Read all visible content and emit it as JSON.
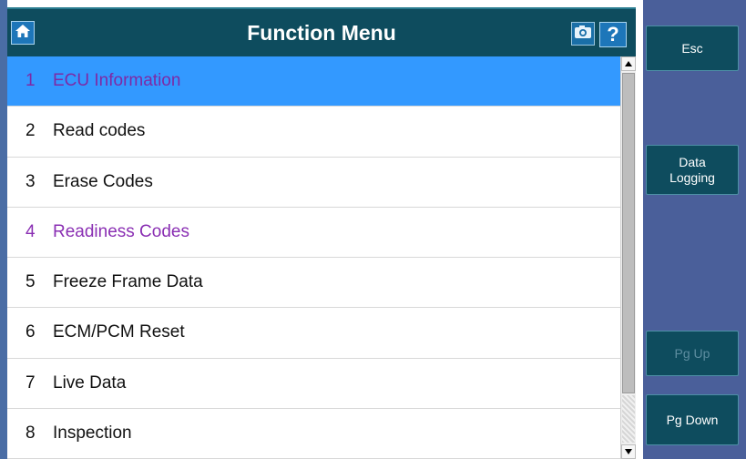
{
  "header": {
    "title": "Function Menu",
    "home_icon": "home-icon",
    "camera_icon": "camera-icon",
    "help_label": "?"
  },
  "menu": {
    "items": [
      {
        "number": "1",
        "label": "ECU Information",
        "state": "selected"
      },
      {
        "number": "2",
        "label": "Read codes",
        "state": "normal"
      },
      {
        "number": "3",
        "label": "Erase Codes",
        "state": "normal"
      },
      {
        "number": "4",
        "label": "Readiness Codes",
        "state": "visited"
      },
      {
        "number": "5",
        "label": "Freeze Frame Data",
        "state": "normal"
      },
      {
        "number": "6",
        "label": "ECM/PCM Reset",
        "state": "normal"
      },
      {
        "number": "7",
        "label": "Live Data",
        "state": "normal"
      },
      {
        "number": "8",
        "label": "Inspection",
        "state": "normal"
      }
    ]
  },
  "side_buttons": {
    "esc": "Esc",
    "data_logging": "Data\nLogging",
    "pg_up": "Pg Up",
    "pg_down": "Pg Down"
  },
  "colors": {
    "title_bar": "#0e4c5e",
    "selection": "#3399ff",
    "visited_text": "#8a2fb3",
    "side_panel": "#4a5f9a"
  }
}
